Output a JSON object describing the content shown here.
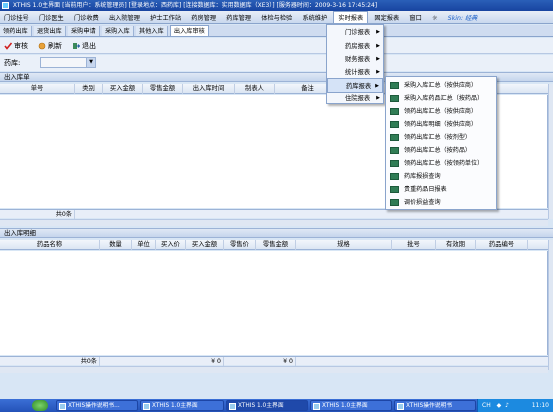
{
  "window": {
    "title": "XTHIS 1.0主界面",
    "status": "[当前用户：系统管理员] [登录地点：西药库] [连接数据库：实用数据库（XE3）] [服务器时间：2009-3-16 17:45:24]"
  },
  "menu": [
    {
      "label": "门诊挂号"
    },
    {
      "label": "门诊医生"
    },
    {
      "label": "门诊收费"
    },
    {
      "label": "出入院管理"
    },
    {
      "label": "护士工作站"
    },
    {
      "label": "药房管理"
    },
    {
      "label": "药库管理"
    },
    {
      "label": "体检与检验"
    },
    {
      "label": "系统维护"
    },
    {
      "label": "实时报表"
    },
    {
      "label": "固定报表"
    },
    {
      "label": "窗口"
    }
  ],
  "skin_label": "Skin: 经典",
  "tabs": [
    {
      "label": "领药出库"
    },
    {
      "label": "退货出库"
    },
    {
      "label": "采购申请"
    },
    {
      "label": "采购入库"
    },
    {
      "label": "其他入库"
    },
    {
      "label": "出入库审核"
    }
  ],
  "toolbar": {
    "audit_label": "审核",
    "refresh_label": "刷新",
    "exit_label": "退出"
  },
  "filter": {
    "label": "药库:",
    "value": ""
  },
  "upper_panel": {
    "title": "出入库单",
    "columns": [
      "单号",
      "类别",
      "买入金额",
      "零售金额",
      "出入库时间",
      "制表人",
      "备注"
    ],
    "footer_count": "共0条"
  },
  "lower_panel": {
    "title": "出入库明细",
    "columns": [
      "药品名称",
      "数量",
      "单位",
      "买入价",
      "买入金额",
      "零售价",
      "零售金额",
      "规格",
      "批号",
      "有效期",
      "药品编号"
    ],
    "footer_count": "共0条",
    "footer_buy_total": "¥ 0",
    "footer_retail_total": "¥ 0"
  },
  "submenu_level1": [
    {
      "label": "门诊报表"
    },
    {
      "label": "药房报表"
    },
    {
      "label": "财务报表"
    },
    {
      "label": "统计报表"
    },
    {
      "label": "药库报表"
    },
    {
      "label": "住院报表"
    }
  ],
  "submenu_level2": [
    {
      "label": "采购入库汇总（按供应商）"
    },
    {
      "label": "采购入库药品汇总（按药品）"
    },
    {
      "label": "领药出库汇总（按供应商）"
    },
    {
      "label": "领药出库明细（按供应商）"
    },
    {
      "label": "领药出库汇总（按剂型）"
    },
    {
      "label": "领药出库汇总（按药品）"
    },
    {
      "label": "领药出库汇总（按领药单位）"
    },
    {
      "label": "药库报损查询"
    },
    {
      "label": "贵重药品日报表"
    },
    {
      "label": "调价损益查询"
    }
  ],
  "taskbar": {
    "tasks": [
      {
        "label": "XTHIS操作说明书..."
      },
      {
        "label": "XTHIS 1.0主界面"
      },
      {
        "label": "XTHIS 1.0主界面"
      },
      {
        "label": "XTHIS 1.0主界面"
      },
      {
        "label": "XTHIS操作说明书"
      }
    ],
    "time": "11:10",
    "lang": "CH"
  },
  "colors": {
    "accent": "#2452b8",
    "header": "#c5d5ec",
    "highlight": "#d5e3f7"
  }
}
